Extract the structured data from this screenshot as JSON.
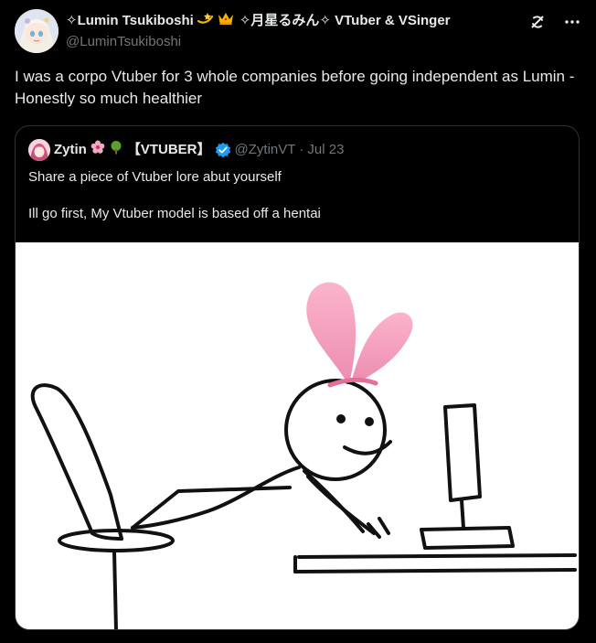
{
  "tweet": {
    "author_name": "✧Lumin Tsukiboshi",
    "author_name_suffix": "✧月星るみん✧ VTuber & VSinger",
    "handle": "@LuminTsukiboshi",
    "text": "I was a corpo Vtuber for 3 whole companies before going independent as Lumin - Honestly so much healthier"
  },
  "quote": {
    "author_name": "Zytin",
    "author_tag": "【VTUBER】",
    "handle": "@ZytinVT",
    "separator": "·",
    "date": "Jul 23",
    "line1": "Share a piece of Vtuber lore abut yourself",
    "line2": "Ill go first, My Vtuber model is based off a hentai"
  },
  "colors": {
    "background": "#000000",
    "text": "#e7e9ea",
    "secondary_text": "#71767b",
    "border": "#2f3336",
    "verified": "#1d9bf0",
    "bunny_ears": "#f7a3c0"
  },
  "icons": [
    "grok-icon",
    "more-icon",
    "dizzy-emoji-icon",
    "crown-emoji-icon",
    "cherry-blossom-emoji-icon",
    "tree-emoji-icon",
    "verified-badge-icon"
  ]
}
